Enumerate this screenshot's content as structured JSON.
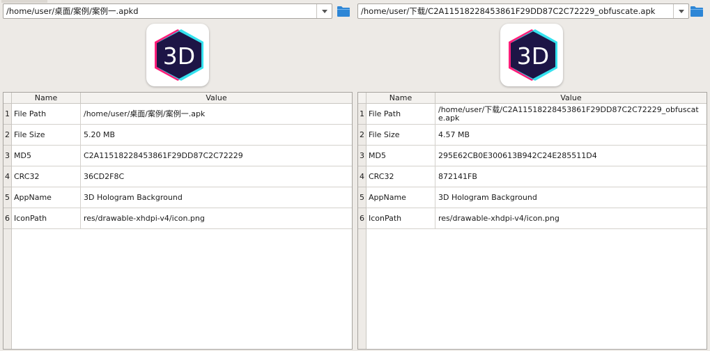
{
  "columns": {
    "name": "Name",
    "value": "Value"
  },
  "icon_name": "3d-hologram-app-icon",
  "icon_text": "3D",
  "colors": {
    "folder": "#2d86d6",
    "icon_bg": "#1d1546",
    "icon_pink": "#ff1f7a",
    "icon_cyan": "#35e1ee"
  },
  "left": {
    "path": "/home/user/桌面/案例/案例一.apkd",
    "rows": [
      {
        "num": "1",
        "name": "File Path",
        "value": "/home/user/桌面/案例/案例一.apk"
      },
      {
        "num": "2",
        "name": "File Size",
        "value": "5.20 MB"
      },
      {
        "num": "3",
        "name": "MD5",
        "value": "C2A11518228453861F29DD87C2C72229"
      },
      {
        "num": "4",
        "name": "CRC32",
        "value": "36CD2F8C"
      },
      {
        "num": "5",
        "name": "AppName",
        "value": "3D Hologram Background"
      },
      {
        "num": "6",
        "name": "IconPath",
        "value": "res/drawable-xhdpi-v4/icon.png"
      }
    ]
  },
  "right": {
    "path": "/home/user/下载/C2A11518228453861F29DD87C2C72229_obfuscate.apk",
    "rows": [
      {
        "num": "1",
        "name": "File Path",
        "value": "/home/user/下载/C2A11518228453861F29DD87C2C72229_obfuscate.apk"
      },
      {
        "num": "2",
        "name": "File Size",
        "value": "4.57 MB"
      },
      {
        "num": "3",
        "name": "MD5",
        "value": "295E62CB0E300613B942C24E285511D4"
      },
      {
        "num": "4",
        "name": "CRC32",
        "value": "872141FB"
      },
      {
        "num": "5",
        "name": "AppName",
        "value": "3D Hologram Background"
      },
      {
        "num": "6",
        "name": "IconPath",
        "value": "res/drawable-xhdpi-v4/icon.png"
      }
    ]
  }
}
